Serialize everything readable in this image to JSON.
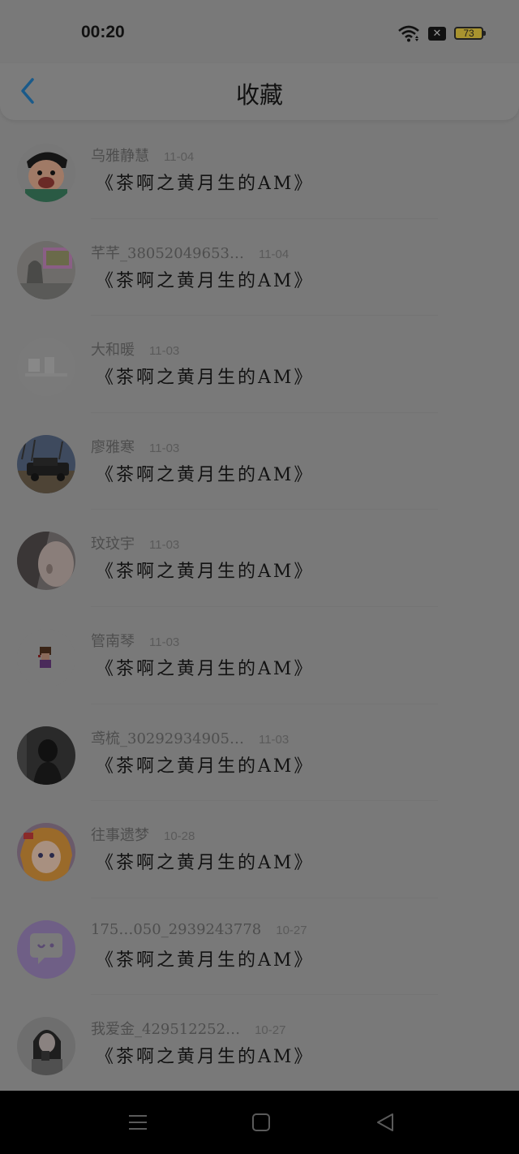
{
  "status": {
    "time": "00:20",
    "battery": "73",
    "x_icon": "x-box-icon"
  },
  "header": {
    "title": "收藏",
    "back_icon": "chevron-left-icon"
  },
  "items": [
    {
      "name": "乌雅静慧",
      "date": "11-04",
      "subject": "《茶啊之黄月生的AM》",
      "avatar": "cartoon-avatar"
    },
    {
      "name": "芊芊_38052049653…",
      "date": "11-04",
      "subject": "《茶啊之黄月生的AM》",
      "avatar": "photo-avatar"
    },
    {
      "name": "大和暖",
      "date": "11-03",
      "subject": "《茶啊之黄月生的AM》",
      "avatar": "faded-avatar"
    },
    {
      "name": "廖雅寒",
      "date": "11-03",
      "subject": "《茶啊之黄月生的AM》",
      "avatar": "car-avatar"
    },
    {
      "name": "玟玟宇",
      "date": "11-03",
      "subject": "《茶啊之黄月生的AM》",
      "avatar": "face-avatar"
    },
    {
      "name": "管南琴",
      "date": "11-03",
      "subject": "《茶啊之黄月生的AM》",
      "avatar": "pixel-avatar"
    },
    {
      "name": "鸢梳_30292934905…",
      "date": "11-03",
      "subject": "《茶啊之黄月生的AM》",
      "avatar": "dark-avatar"
    },
    {
      "name": "往事遗梦",
      "date": "10-28",
      "subject": "《茶啊之黄月生的AM》",
      "avatar": "anime-avatar"
    },
    {
      "name": "175…050_2939243778",
      "date": "10-27",
      "subject": "《茶啊之黄月生的AM》",
      "avatar": "chat-bubble-avatar"
    },
    {
      "name": "我爱金_429512252…",
      "date": "10-27",
      "subject": "《茶啊之黄月生的AM》",
      "avatar": "girl-avatar"
    }
  ],
  "nav": {
    "menu_icon": "menu-icon",
    "home_icon": "square-icon",
    "back_icon": "triangle-back-icon"
  }
}
